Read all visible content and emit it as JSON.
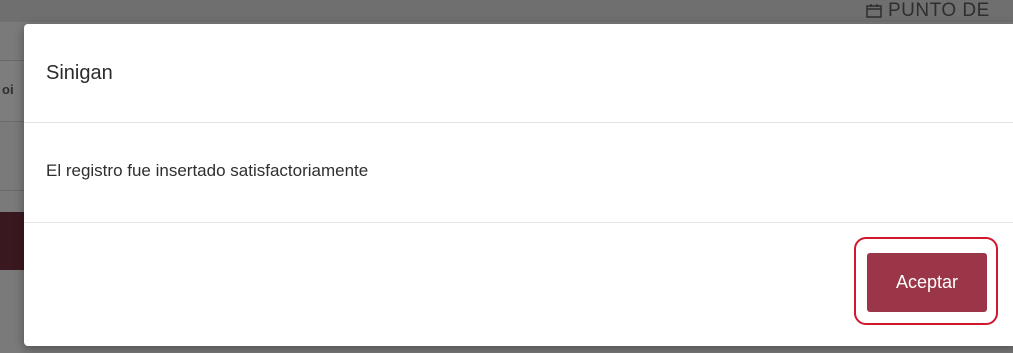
{
  "background": {
    "heading": "PUNTO DE",
    "left_text": "oi"
  },
  "dialog": {
    "title": "Sinigan",
    "message": "El registro fue insertado satisfactoriamente",
    "accept_label": "Aceptar"
  },
  "colors": {
    "accent": "#9b3648",
    "focus_ring": "#d2162b",
    "overlay": "#7a7a7a"
  },
  "icons": {
    "heading_icon": "calendar-icon"
  }
}
